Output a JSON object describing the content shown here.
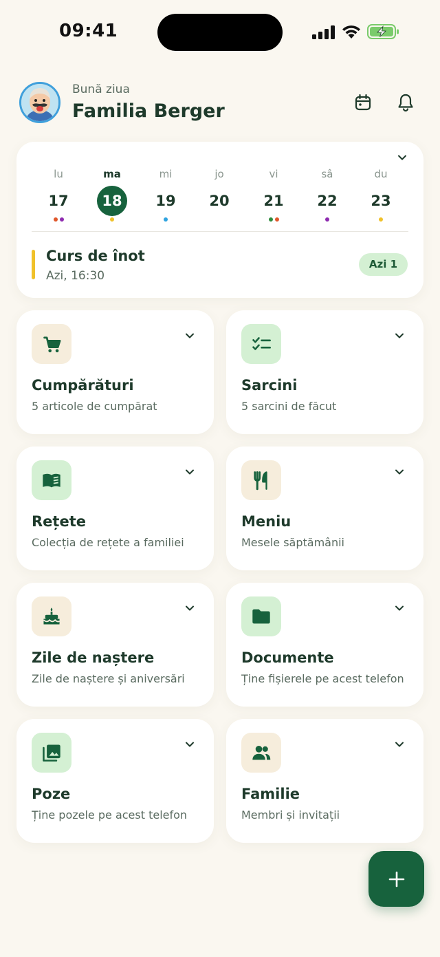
{
  "status_bar": {
    "time": "09:41"
  },
  "header": {
    "greeting": "Bună ziua",
    "family_name": "Familia Berger"
  },
  "calendar": {
    "days": [
      {
        "abbr": "lu",
        "num": "17",
        "dots": [
          "#E0572B",
          "#8E2BB0"
        ]
      },
      {
        "abbr": "ma",
        "num": "18",
        "dots": [
          "#F0C12A"
        ],
        "selected": true
      },
      {
        "abbr": "mi",
        "num": "19",
        "dots": [
          "#2FA3E0"
        ]
      },
      {
        "abbr": "jo",
        "num": "20",
        "dots": []
      },
      {
        "abbr": "vi",
        "num": "21",
        "dots": [
          "#2E8B3D",
          "#E0572B"
        ]
      },
      {
        "abbr": "sâ",
        "num": "22",
        "dots": [
          "#8E2BB0"
        ]
      },
      {
        "abbr": "du",
        "num": "23",
        "dots": [
          "#F0C12A"
        ]
      }
    ],
    "event": {
      "title": "Curs de înot",
      "time": "Azi, 16:30",
      "badge": "Azi 1",
      "color": "#F0C12A"
    }
  },
  "tiles": [
    {
      "title": "Cumpărături",
      "subtitle": "5 articole de cumpărat",
      "icon": "cart-icon"
    },
    {
      "title": "Sarcini",
      "subtitle": "5 sarcini de făcut",
      "icon": "checklist-icon"
    },
    {
      "title": "Rețete",
      "subtitle": "Colecția de rețete a familiei",
      "icon": "book-icon"
    },
    {
      "title": "Meniu",
      "subtitle": "Mesele săptămânii",
      "icon": "cutlery-icon"
    },
    {
      "title": "Zile de naștere",
      "subtitle": "Zile de naștere și aniversări",
      "icon": "cake-icon"
    },
    {
      "title": "Documente",
      "subtitle": "Ține fișierele pe acest telefon",
      "icon": "folder-icon"
    },
    {
      "title": "Poze",
      "subtitle": "Ține pozele pe acest telefon",
      "icon": "photos-icon"
    },
    {
      "title": "Familie",
      "subtitle": "Membri și invitații",
      "icon": "people-icon"
    }
  ],
  "colors": {
    "accent": "#17623D",
    "background": "#FAF7F0",
    "badge_bg": "#D4F0D3"
  }
}
